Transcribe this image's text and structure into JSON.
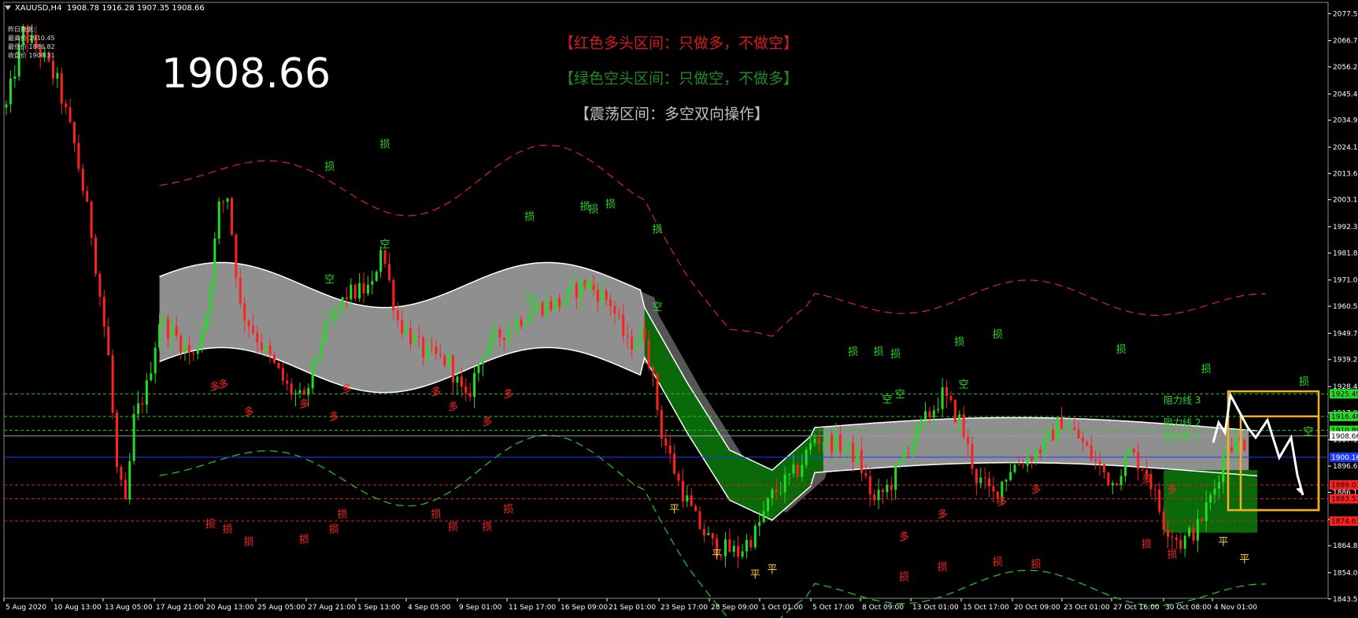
{
  "header": {
    "title": "XAUUSD,H4",
    "ohlc": "1908.78 1916.28 1907.35 1908.66"
  },
  "prev_day": {
    "label": "昨日数据:",
    "high": "最高价 1910.45",
    "low": "最低价 1886.82",
    "close": "收盘价 1908.31"
  },
  "current_price": "1908.66",
  "notices": {
    "red": "【红色多头区间：只做多，不做空】",
    "green": "【绿色空头区间：只做空，不做多】",
    "range": "【震荡区间：多空双向操作】"
  },
  "resistance_labels": [
    "阻力线 3",
    "阻力线 2",
    "阻力线 1"
  ],
  "colors": {
    "bull": "#ff2020",
    "bear": "#22dd22",
    "band": "#8f8f8f",
    "band_dark": "#555555",
    "green_fill": "#0a6a0a",
    "blue_line": "#1a3cff",
    "box": "#f2b01e",
    "dash_green": "#22cc22",
    "dash_red": "#dd2222"
  },
  "chart_data": {
    "type": "candlestick",
    "symbol": "XAUUSD",
    "timeframe": "H4",
    "ylim": [
      1843.75,
      2082.0
    ],
    "y_ticks": [
      "2077.50",
      "2066.70",
      "2056.20",
      "2045.40",
      "2034.90",
      "2024.10",
      "2013.60",
      "2003.10",
      "1992.30",
      "1981.80",
      "1971.00",
      "1960.50",
      "1949.70",
      "1939.20",
      "1928.40",
      "1917.90",
      "1907.10",
      "1896.60",
      "1886.10",
      "1875.30",
      "1864.80",
      "1854.00",
      "1843.50"
    ],
    "x_ticks": [
      "5 Aug 2020",
      "10 Aug 13:00",
      "13 Aug 05:00",
      "17 Aug 21:00",
      "20 Aug 13:00",
      "25 Aug 05:00",
      "27 Aug 21:00",
      "1 Sep 13:00",
      "4 Sep 05:00",
      "9 Sep 01:00",
      "11 Sep 17:00",
      "16 Sep 09:00",
      "21 Sep 01:00",
      "23 Sep 17:00",
      "28 Sep 09:00",
      "1 Oct 01:00",
      "5 Oct 17:00",
      "8 Oct 09:00",
      "13 Oct 01:00",
      "15 Oct 17:00",
      "20 Oct 09:00",
      "23 Oct 01:00",
      "27 Oct 16:00",
      "30 Oct 08:00",
      "4 Nov 01:00"
    ],
    "price_boxes": [
      {
        "price": 1925.49,
        "text": "1925.49",
        "bg": "#22dd22"
      },
      {
        "price": 1916.46,
        "text": "1916.46",
        "bg": "#22dd22"
      },
      {
        "price": 1910.89,
        "text": "1910.89",
        "bg": "#22dd22"
      },
      {
        "price": 1908.66,
        "text": "1908.66",
        "bg": "#ffffff"
      },
      {
        "price": 1900.16,
        "text": "1900.16",
        "bg": "#1a3cff"
      },
      {
        "price": 1889.07,
        "text": "1889.07",
        "bg": "#ff2020"
      },
      {
        "price": 1883.53,
        "text": "1883.53",
        "bg": "#ff2020"
      },
      {
        "price": 1874.63,
        "text": "1874.63",
        "bg": "#ff2020"
      }
    ],
    "levels": {
      "resistance": [
        1925.49,
        1916.46,
        1910.89
      ],
      "pivot": 1900.16,
      "support": [
        1889.07,
        1883.53,
        1874.63
      ]
    },
    "close_path": [
      [
        0,
        2040
      ],
      [
        4,
        2070
      ],
      [
        8,
        2062
      ],
      [
        12,
        2050
      ],
      [
        16,
        2025
      ],
      [
        20,
        1990
      ],
      [
        24,
        1940
      ],
      [
        26,
        1895
      ],
      [
        28,
        1880
      ],
      [
        30,
        1915
      ],
      [
        33,
        1928
      ],
      [
        36,
        1955
      ],
      [
        40,
        1948
      ],
      [
        44,
        1940
      ],
      [
        47,
        1958
      ],
      [
        50,
        2000
      ],
      [
        52,
        2005
      ],
      [
        55,
        1960
      ],
      [
        60,
        1945
      ],
      [
        66,
        1928
      ],
      [
        70,
        1922
      ],
      [
        74,
        1948
      ],
      [
        80,
        1965
      ],
      [
        86,
        1968
      ],
      [
        88,
        1985
      ],
      [
        92,
        1955
      ],
      [
        98,
        1942
      ],
      [
        104,
        1938
      ],
      [
        108,
        1922
      ],
      [
        112,
        1943
      ],
      [
        118,
        1952
      ],
      [
        124,
        1960
      ],
      [
        130,
        1962
      ],
      [
        136,
        1970
      ],
      [
        142,
        1962
      ],
      [
        146,
        1945
      ],
      [
        150,
        1950
      ],
      [
        154,
        1910
      ],
      [
        158,
        1890
      ],
      [
        162,
        1875
      ],
      [
        166,
        1865
      ],
      [
        172,
        1862
      ],
      [
        176,
        1870
      ],
      [
        180,
        1885
      ],
      [
        186,
        1895
      ],
      [
        190,
        1908
      ],
      [
        196,
        1905
      ],
      [
        200,
        1900
      ],
      [
        204,
        1882
      ],
      [
        208,
        1890
      ],
      [
        212,
        1905
      ],
      [
        216,
        1915
      ],
      [
        220,
        1925
      ],
      [
        224,
        1915
      ],
      [
        228,
        1892
      ],
      [
        232,
        1885
      ],
      [
        236,
        1896
      ],
      [
        240,
        1900
      ],
      [
        244,
        1905
      ],
      [
        248,
        1915
      ],
      [
        252,
        1908
      ],
      [
        256,
        1898
      ],
      [
        260,
        1890
      ],
      [
        264,
        1902
      ],
      [
        268,
        1895
      ],
      [
        272,
        1874
      ],
      [
        276,
        1866
      ],
      [
        280,
        1872
      ],
      [
        284,
        1888
      ],
      [
        287,
        1906
      ]
    ],
    "signals": [
      {
        "text": "多",
        "x": 49,
        "y": 1927,
        "c": "r"
      },
      {
        "text": "多",
        "x": 51,
        "y": 1928,
        "c": "r"
      },
      {
        "text": "多",
        "x": 57,
        "y": 1917,
        "c": "r"
      },
      {
        "text": "多",
        "x": 70,
        "y": 1920,
        "c": "r"
      },
      {
        "text": "多",
        "x": 77,
        "y": 1915,
        "c": "r"
      },
      {
        "text": "多",
        "x": 80,
        "y": 1926,
        "c": "r"
      },
      {
        "text": "多",
        "x": 101,
        "y": 1925,
        "c": "r"
      },
      {
        "text": "多",
        "x": 105,
        "y": 1919,
        "c": "r"
      },
      {
        "text": "多",
        "x": 113,
        "y": 1913,
        "c": "r"
      },
      {
        "text": "多",
        "x": 118,
        "y": 1924,
        "c": "r"
      },
      {
        "text": "空",
        "x": 76,
        "y": 1970,
        "c": "g"
      },
      {
        "text": "空",
        "x": 89,
        "y": 1984,
        "c": "g"
      },
      {
        "text": "空",
        "x": 123,
        "y": 1962,
        "c": "g"
      },
      {
        "text": "空",
        "x": 137,
        "y": 1967,
        "c": "g"
      },
      {
        "text": "空",
        "x": 153,
        "y": 1959,
        "c": "g"
      },
      {
        "text": "空",
        "x": 207,
        "y": 1922,
        "c": "g"
      },
      {
        "text": "空",
        "x": 210,
        "y": 1924,
        "c": "g"
      },
      {
        "text": "空",
        "x": 225,
        "y": 1928,
        "c": "g"
      },
      {
        "text": "空",
        "x": 306,
        "y": 1909,
        "c": "g"
      },
      {
        "text": "损",
        "x": 76,
        "y": 2015,
        "c": "g"
      },
      {
        "text": "损",
        "x": 89,
        "y": 2024,
        "c": "g"
      },
      {
        "text": "损",
        "x": 123,
        "y": 1995,
        "c": "g"
      },
      {
        "text": "损",
        "x": 136,
        "y": 1999,
        "c": "g"
      },
      {
        "text": "损",
        "x": 138,
        "y": 1998,
        "c": "g"
      },
      {
        "text": "损",
        "x": 142,
        "y": 2000,
        "c": "g"
      },
      {
        "text": "损",
        "x": 153,
        "y": 1990,
        "c": "g"
      },
      {
        "text": "损",
        "x": 199,
        "y": 1941,
        "c": "g"
      },
      {
        "text": "损",
        "x": 205,
        "y": 1941,
        "c": "g"
      },
      {
        "text": "损",
        "x": 209,
        "y": 1940,
        "c": "g"
      },
      {
        "text": "损",
        "x": 224,
        "y": 1945,
        "c": "g"
      },
      {
        "text": "损",
        "x": 233,
        "y": 1948,
        "c": "g"
      },
      {
        "text": "损",
        "x": 262,
        "y": 1942,
        "c": "g"
      },
      {
        "text": "损",
        "x": 282,
        "y": 1934,
        "c": "g"
      },
      {
        "text": "损",
        "x": 305,
        "y": 1929,
        "c": "g"
      },
      {
        "text": "损",
        "x": 48,
        "y": 1872,
        "c": "r"
      },
      {
        "text": "损",
        "x": 52,
        "y": 1870,
        "c": "r"
      },
      {
        "text": "损",
        "x": 57,
        "y": 1865,
        "c": "r"
      },
      {
        "text": "损",
        "x": 70,
        "y": 1866,
        "c": "r"
      },
      {
        "text": "损",
        "x": 77,
        "y": 1870,
        "c": "r"
      },
      {
        "text": "损",
        "x": 79,
        "y": 1876,
        "c": "r"
      },
      {
        "text": "损",
        "x": 101,
        "y": 1876,
        "c": "r"
      },
      {
        "text": "损",
        "x": 105,
        "y": 1871,
        "c": "r"
      },
      {
        "text": "损",
        "x": 113,
        "y": 1871,
        "c": "r"
      },
      {
        "text": "损",
        "x": 118,
        "y": 1878,
        "c": "r"
      },
      {
        "text": "损",
        "x": 211,
        "y": 1851,
        "c": "r"
      },
      {
        "text": "损",
        "x": 220,
        "y": 1855,
        "c": "r"
      },
      {
        "text": "损",
        "x": 233,
        "y": 1857,
        "c": "r"
      },
      {
        "text": "损",
        "x": 242,
        "y": 1856,
        "c": "r"
      },
      {
        "text": "损",
        "x": 268,
        "y": 1864,
        "c": "r"
      },
      {
        "text": "损",
        "x": 274,
        "y": 1860,
        "c": "r"
      },
      {
        "text": "多",
        "x": 211,
        "y": 1867,
        "c": "r"
      },
      {
        "text": "多",
        "x": 220,
        "y": 1876,
        "c": "r"
      },
      {
        "text": "多",
        "x": 234,
        "y": 1881,
        "c": "r"
      },
      {
        "text": "多",
        "x": 242,
        "y": 1886,
        "c": "r"
      },
      {
        "text": "多",
        "x": 268,
        "y": 1890,
        "c": "r"
      },
      {
        "text": "多",
        "x": 274,
        "y": 1886,
        "c": "r"
      },
      {
        "text": "平",
        "x": 157,
        "y": 1878,
        "c": "y"
      },
      {
        "text": "平",
        "x": 167,
        "y": 1860,
        "c": "y"
      },
      {
        "text": "平",
        "x": 176,
        "y": 1852,
        "c": "y"
      },
      {
        "text": "平",
        "x": 180,
        "y": 1854,
        "c": "y"
      },
      {
        "text": "平",
        "x": 286,
        "y": 1865,
        "c": "y"
      },
      {
        "text": "平",
        "x": 291,
        "y": 1858,
        "c": "y"
      }
    ]
  }
}
